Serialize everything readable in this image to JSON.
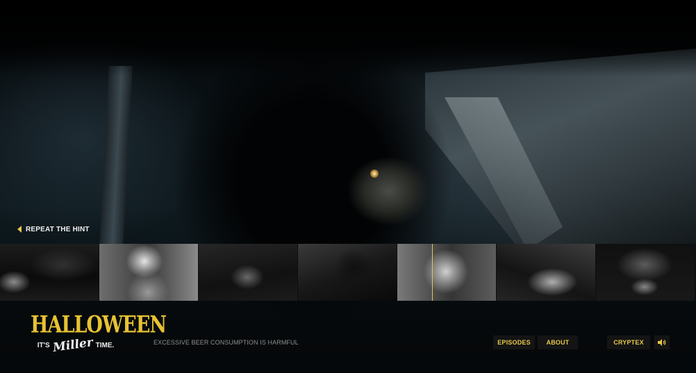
{
  "hint": {
    "label": "REPEAT THE HINT"
  },
  "episodes_strip": {
    "thumbnails": [
      {
        "name": "episode-thumbnail-1"
      },
      {
        "name": "episode-thumbnail-2"
      },
      {
        "name": "episode-thumbnail-3"
      },
      {
        "name": "episode-thumbnail-4"
      },
      {
        "name": "episode-thumbnail-5"
      },
      {
        "name": "episode-thumbnail-6"
      },
      {
        "name": "episode-thumbnail-7"
      }
    ]
  },
  "logo": {
    "title": "HALLOWEEN",
    "tagline_left": "IT'S",
    "brand": "Miller",
    "tagline_right": "TIME."
  },
  "footer": {
    "disclaimer": "EXCESSIVE BEER CONSUMPTION IS HARMFUL"
  },
  "nav": {
    "episodes": "EPISODES",
    "about": "ABOUT",
    "cryptex": "CRYPTEX"
  },
  "colors": {
    "accent": "#e6c84a",
    "button_bg": "#141414",
    "background": "#050709"
  },
  "icons": {
    "hint_arrow": "triangle-left-icon",
    "sound": "speaker-icon"
  }
}
